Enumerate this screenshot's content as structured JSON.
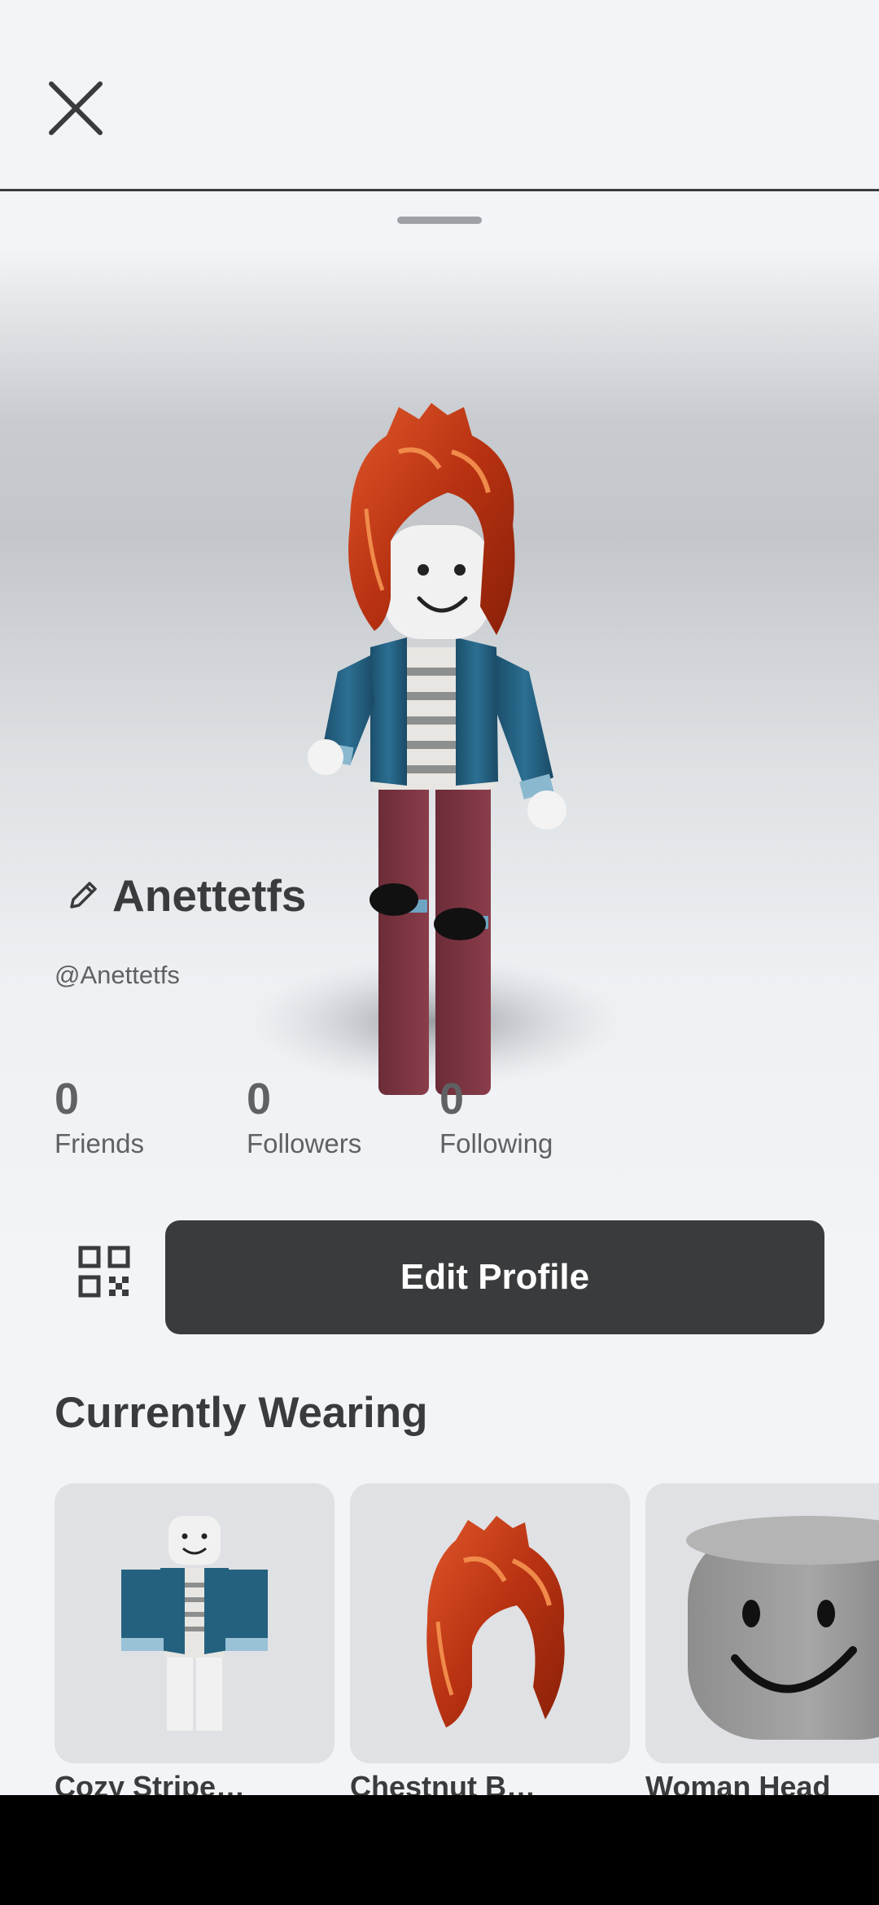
{
  "header": {
    "close_icon": "close-icon"
  },
  "profile": {
    "display_name": "Anettetfs",
    "username": "@Anettetfs",
    "edit_icon": "pencil-icon"
  },
  "stats": [
    {
      "value": "0",
      "label": "Friends"
    },
    {
      "value": "0",
      "label": "Followers"
    },
    {
      "value": "0",
      "label": "Following"
    }
  ],
  "actions": {
    "qr_icon": "qr-code-icon",
    "edit_profile_label": "Edit Profile"
  },
  "currently_wearing": {
    "title": "Currently Wearing",
    "items": [
      {
        "label": "Cozy Stripe…",
        "thumbnail": "shirt-thumbnail"
      },
      {
        "label": "Chestnut B…",
        "thumbnail": "hair-thumbnail"
      },
      {
        "label": "Woman Head",
        "thumbnail": "head-thumbnail"
      }
    ]
  },
  "colors": {
    "background": "#f2f4f7",
    "primary_text": "#393b3d",
    "secondary_text": "#606162",
    "button_bg": "#393b3d",
    "button_text": "#ffffff",
    "item_bg": "#dfe1e4"
  }
}
